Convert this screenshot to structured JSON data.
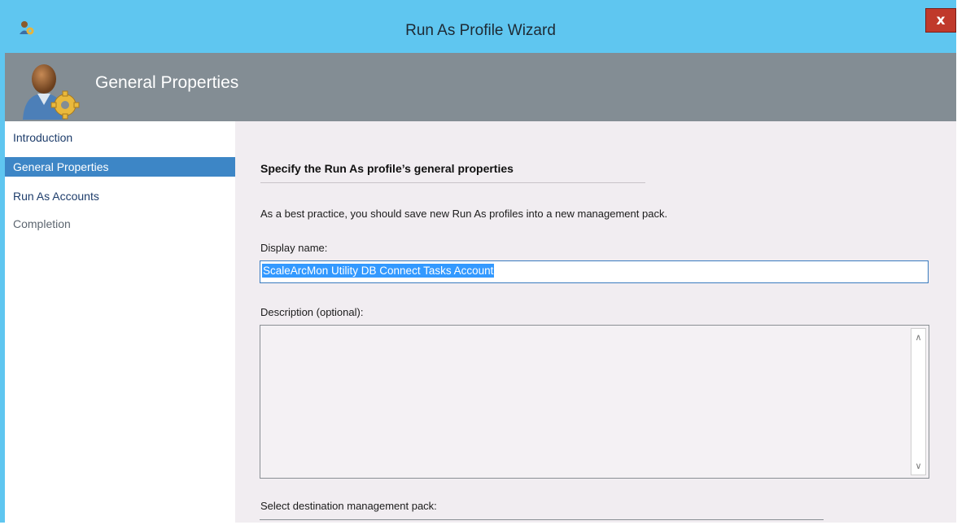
{
  "window": {
    "title": "Run As Profile Wizard",
    "close_label": "x"
  },
  "header": {
    "title": "General Properties"
  },
  "sidebar": {
    "items": [
      {
        "label": "Introduction"
      },
      {
        "label": "General Properties"
      },
      {
        "label": "Run As Accounts"
      },
      {
        "label": "Completion"
      }
    ]
  },
  "main": {
    "heading": "Specify the Run As profile’s general properties",
    "description": "As a best practice, you should save new Run As profiles into a new management pack.",
    "display_name_label": "Display name:",
    "display_name_value": "ScaleArcMon Utility DB Connect Tasks Account",
    "description_label": "Description (optional):",
    "description_value": "",
    "management_pack_label": "Select destination management pack:"
  },
  "colors": {
    "titlebar": "#5fc6f0",
    "header": "#838d94",
    "active_nav": "#3d86c6",
    "content_bg": "#f1edf1",
    "close_button": "#c0392b"
  }
}
